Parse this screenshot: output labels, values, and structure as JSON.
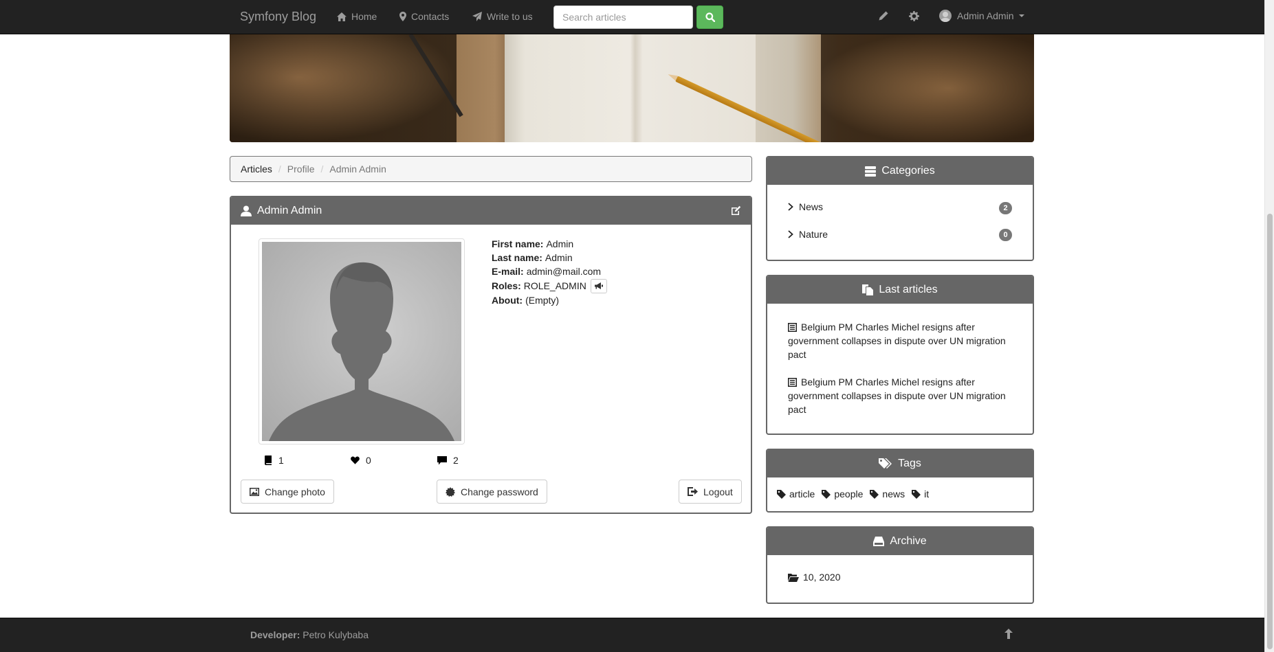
{
  "navbar": {
    "brand": "Symfony Blog",
    "links": [
      {
        "label": "Home",
        "icon": "home-icon"
      },
      {
        "label": "Contacts",
        "icon": "map-marker-icon"
      },
      {
        "label": "Write to us",
        "icon": "send-icon"
      }
    ],
    "search_placeholder": "Search articles",
    "user_name": "Admin Admin"
  },
  "breadcrumb": {
    "items": [
      "Articles",
      "Profile",
      "Admin Admin"
    ]
  },
  "profile": {
    "title": "Admin Admin",
    "fields": {
      "first_name_label": "First name:",
      "first_name": "Admin",
      "last_name_label": "Last name:",
      "last_name": "Admin",
      "email_label": "E-mail:",
      "email": "admin@mail.com",
      "roles_label": "Roles:",
      "roles": "ROLE_ADMIN",
      "about_label": "About:",
      "about": "(Empty)"
    },
    "stats": {
      "articles": "1",
      "likes": "0",
      "comments": "2"
    },
    "buttons": {
      "change_photo": "Change photo",
      "change_password": "Change password",
      "logout": "Logout"
    }
  },
  "sidebar": {
    "categories": {
      "title": "Categories",
      "items": [
        {
          "label": "News",
          "count": "2"
        },
        {
          "label": "Nature",
          "count": "0"
        }
      ]
    },
    "last_articles": {
      "title": "Last articles",
      "items": [
        "Belgium PM Charles Michel resigns after government collapses in dispute over UN migration pact",
        "Belgium PM Charles Michel resigns after government collapses in dispute over UN migration pact"
      ]
    },
    "tags": {
      "title": "Tags",
      "items": [
        "article",
        "people",
        "news",
        "it"
      ]
    },
    "archive": {
      "title": "Archive",
      "items": [
        "10, 2020"
      ]
    }
  },
  "footer": {
    "developer_label": "Developer:",
    "developer_name": "Petro Kulybaba"
  },
  "colors": {
    "navbar_bg": "#222222",
    "panel_heading": "#666666",
    "search_button": "#5cb85c",
    "badge": "#777777"
  }
}
